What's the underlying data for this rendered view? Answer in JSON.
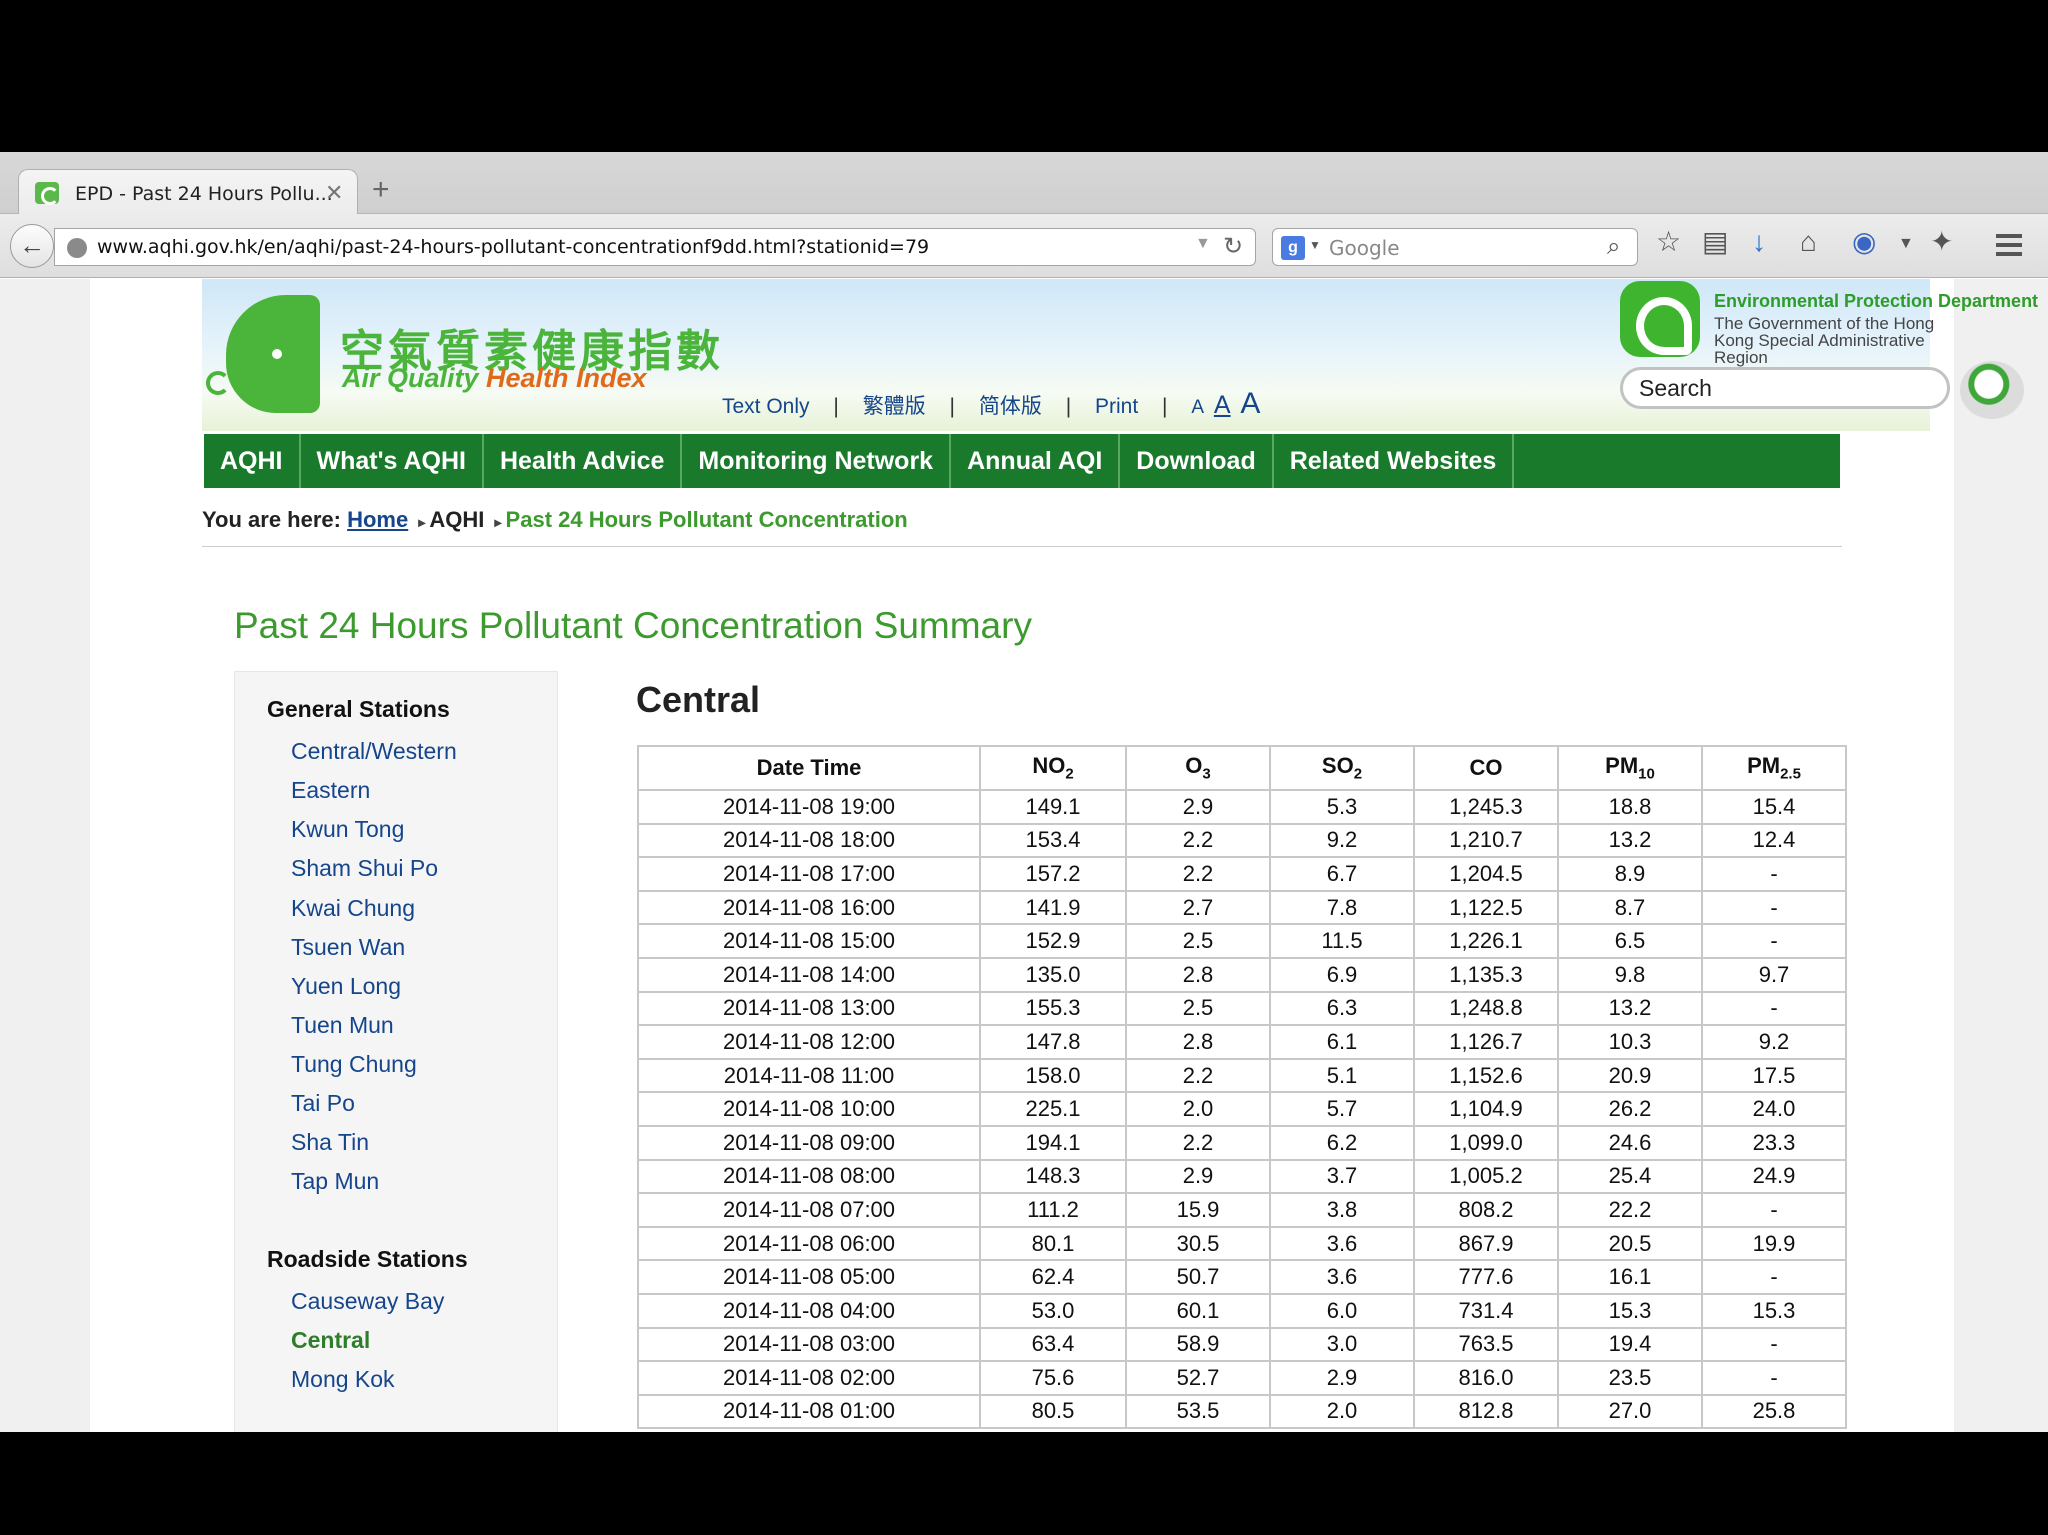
{
  "browser": {
    "tab_title": "EPD - Past 24 Hours Pollu...",
    "tab_close": "✕",
    "new_tab": "+",
    "url": "www.aqhi.gov.hk/en/aqhi/past-24-hours-pollutant-concentrationf9dd.html?stationid=79",
    "search_engine": "Google",
    "icons": [
      "back-arrow-icon",
      "globe-icon",
      "reload-icon",
      "google-icon",
      "search-icon",
      "star-icon",
      "reading-list-icon",
      "download-icon",
      "home-icon",
      "addon-icon",
      "puzzle-icon",
      "menu-icon"
    ]
  },
  "header": {
    "logo_cn": "空氣質素健康指數",
    "logo_en_a": "Air Quality ",
    "logo_en_b": "Health Index",
    "links": [
      "Text Only",
      "|",
      "繁體版",
      "|",
      "简体版",
      "|",
      "Print",
      "|"
    ],
    "font_sizes": [
      "A",
      "A",
      "A"
    ],
    "epd_name": "Environmental Protection Department",
    "gov_name": "The Government of the Hong Kong Special Administrative Region",
    "search_value": "Search"
  },
  "nav": [
    "AQHI",
    "What's AQHI",
    "Health Advice",
    "Monitoring Network",
    "Annual AQI",
    "Download",
    "Related Websites"
  ],
  "breadcrumb": {
    "label": "You are here:",
    "home": "Home",
    "arrow": "▸",
    "aqhi": "AQHI",
    "current": "Past 24 Hours Pollutant Concentration"
  },
  "page_title": "Past 24 Hours Pollutant Concentration Summary",
  "sidebar": {
    "general_heading": "General Stations",
    "general": [
      "Central/Western",
      "Eastern",
      "Kwun Tong",
      "Sham Shui Po",
      "Kwai Chung",
      "Tsuen Wan",
      "Yuen Long",
      "Tuen Mun",
      "Tung Chung",
      "Tai Po",
      "Sha Tin",
      "Tap Mun"
    ],
    "roadside_heading": "Roadside Stations",
    "roadside": [
      "Causeway Bay",
      "Central",
      "Mong Kok"
    ],
    "active": "Central"
  },
  "station": "Central",
  "table": {
    "headers": [
      {
        "main": "Date Time",
        "sub": ""
      },
      {
        "main": "NO",
        "sub": "2"
      },
      {
        "main": "O",
        "sub": "3"
      },
      {
        "main": "SO",
        "sub": "2"
      },
      {
        "main": "CO",
        "sub": ""
      },
      {
        "main": "PM",
        "sub": "10"
      },
      {
        "main": "PM",
        "sub": "2.5"
      }
    ],
    "rows": [
      [
        "2014-11-08 19:00",
        "149.1",
        "2.9",
        "5.3",
        "1,245.3",
        "18.8",
        "15.4"
      ],
      [
        "2014-11-08 18:00",
        "153.4",
        "2.2",
        "9.2",
        "1,210.7",
        "13.2",
        "12.4"
      ],
      [
        "2014-11-08 17:00",
        "157.2",
        "2.2",
        "6.7",
        "1,204.5",
        "8.9",
        "-"
      ],
      [
        "2014-11-08 16:00",
        "141.9",
        "2.7",
        "7.8",
        "1,122.5",
        "8.7",
        "-"
      ],
      [
        "2014-11-08 15:00",
        "152.9",
        "2.5",
        "11.5",
        "1,226.1",
        "6.5",
        "-"
      ],
      [
        "2014-11-08 14:00",
        "135.0",
        "2.8",
        "6.9",
        "1,135.3",
        "9.8",
        "9.7"
      ],
      [
        "2014-11-08 13:00",
        "155.3",
        "2.5",
        "6.3",
        "1,248.8",
        "13.2",
        "-"
      ],
      [
        "2014-11-08 12:00",
        "147.8",
        "2.8",
        "6.1",
        "1,126.7",
        "10.3",
        "9.2"
      ],
      [
        "2014-11-08 11:00",
        "158.0",
        "2.2",
        "5.1",
        "1,152.6",
        "20.9",
        "17.5"
      ],
      [
        "2014-11-08 10:00",
        "225.1",
        "2.0",
        "5.7",
        "1,104.9",
        "26.2",
        "24.0"
      ],
      [
        "2014-11-08 09:00",
        "194.1",
        "2.2",
        "6.2",
        "1,099.0",
        "24.6",
        "23.3"
      ],
      [
        "2014-11-08 08:00",
        "148.3",
        "2.9",
        "3.7",
        "1,005.2",
        "25.4",
        "24.9"
      ],
      [
        "2014-11-08 07:00",
        "111.2",
        "15.9",
        "3.8",
        "808.2",
        "22.2",
        "-"
      ],
      [
        "2014-11-08 06:00",
        "80.1",
        "30.5",
        "3.6",
        "867.9",
        "20.5",
        "19.9"
      ],
      [
        "2014-11-08 05:00",
        "62.4",
        "50.7",
        "3.6",
        "777.6",
        "16.1",
        "-"
      ],
      [
        "2014-11-08 04:00",
        "53.0",
        "60.1",
        "6.0",
        "731.4",
        "15.3",
        "15.3"
      ],
      [
        "2014-11-08 03:00",
        "63.4",
        "58.9",
        "3.0",
        "763.5",
        "19.4",
        "-"
      ],
      [
        "2014-11-08 02:00",
        "75.6",
        "52.7",
        "2.9",
        "816.0",
        "23.5",
        "-"
      ],
      [
        "2014-11-08 01:00",
        "80.5",
        "53.5",
        "2.0",
        "812.8",
        "27.0",
        "25.8"
      ]
    ]
  },
  "colors": {
    "nav_green": "#197a2c",
    "title_green": "#3c9a2e",
    "link_blue": "#15458a"
  }
}
